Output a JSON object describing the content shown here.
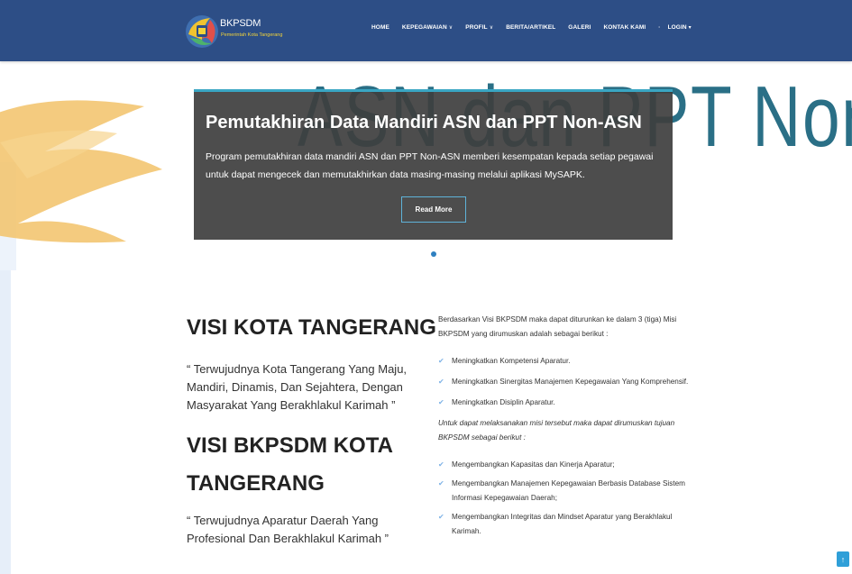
{
  "header": {
    "brand": "BKPSDM",
    "brand_sub": "Pemerintah Kota Tangerang",
    "menu": [
      {
        "label": "HOME",
        "caret": ""
      },
      {
        "label": "KEPEGAWAIAN",
        "caret": "∨"
      },
      {
        "label": "PROFIL",
        "caret": "∨"
      },
      {
        "label": "BERITA/ARTIKEL",
        "caret": ""
      },
      {
        "label": "GALERI",
        "caret": ""
      },
      {
        "label": "KONTAK KAMI",
        "caret": ""
      },
      {
        "label": "LOGIN",
        "caret": "▾"
      }
    ]
  },
  "hero": {
    "background_text": "ASN dan PPT Non ASN",
    "title": "Pemutakhiran Data Mandiri ASN dan PPT Non-ASN",
    "text": "Program pemutakhiran data mandiri ASN dan PPT Non-ASN memberi kesempatan kepada setiap pegawai untuk dapat mengecek dan memutakhirkan data masing-masing melalui aplikasi MySAPK.",
    "button": "Read More"
  },
  "visi": {
    "kota_title": "VISI KOTA TANGERANG",
    "kota_quote": "“ Terwujudnya Kota Tangerang Yang Maju, Mandiri, Dinamis, Dan Sejahtera, Dengan Masyarakat Yang Berakhlakul Karimah ”",
    "bkpsdm_title": "VISI BKPSDM KOTA TANGERANG",
    "bkpsdm_quote": "“ Terwujudnya Aparatur Daerah Yang Profesional Dan Berakhlakul Karimah ”"
  },
  "misi": {
    "intro": "Berdasarkan Visi BKPSDM maka dapat diturunkan ke dalam 3 (tiga) Misi BKPSDM yang dirumuskan adalah sebagai berikut :",
    "items": [
      "Meningkatkan Kompetensi Aparatur.",
      "Meningkatkan Sinergitas Manajemen Kepegawaian Yang Komprehensif.",
      "Meningkatkan Disiplin Aparatur."
    ],
    "tujuan_intro": "Untuk dapat melaksanakan misi tersebut maka dapat dirumuskan tujuan BKPSDM sebagai berikut :",
    "tujuan": [
      "Mengembangkan Kapasitas dan Kinerja Aparatur;",
      "Mengembangkan Manajemen Kepegawaian Berbasis Database Sistem Informasi Kepegawaian Daerah;",
      "Mengembangkan Integritas dan Mindset Aparatur yang Berakhlakul Karimah."
    ]
  },
  "icons": {
    "check": "✔",
    "scroll_top": "↑"
  }
}
